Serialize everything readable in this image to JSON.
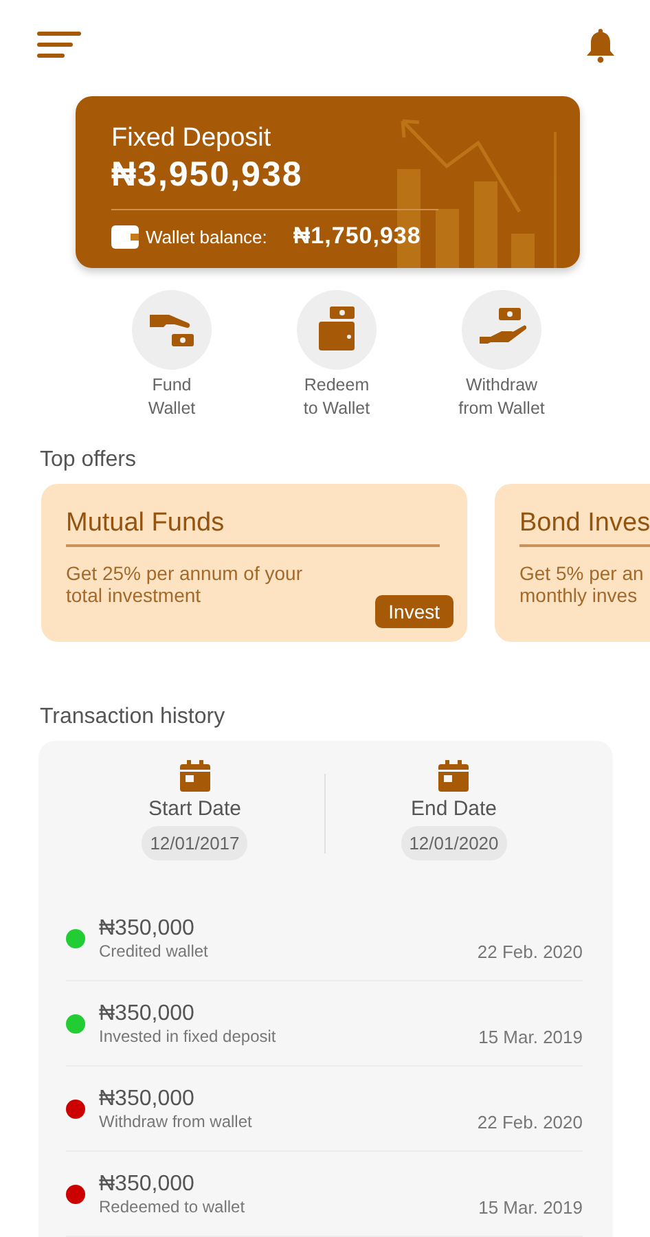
{
  "balance_card": {
    "title": "Fixed Deposit",
    "amount": "₦3,950,938",
    "wallet_label": "Wallet balance:",
    "wallet_amount": "₦1,750,938"
  },
  "actions": [
    {
      "kind": "fund",
      "lines": [
        "Fund",
        "Wallet"
      ]
    },
    {
      "kind": "redeem",
      "lines": [
        "Redeem",
        "to Wallet"
      ]
    },
    {
      "kind": "withdraw",
      "lines": [
        "Withdraw",
        "from Wallet"
      ]
    }
  ],
  "offers_title": "Top offers",
  "offers": [
    {
      "title": "Mutual Funds",
      "description_lines": [
        "Get 25% per annum of your",
        "total investment"
      ],
      "button": "Invest"
    },
    {
      "title": "Bond Inves",
      "description_lines": [
        "Get 5% per an",
        "monthly inves"
      ]
    }
  ],
  "history_title": "Transaction history",
  "date_range": [
    {
      "label": "Start Date",
      "value": "12/01/2017"
    },
    {
      "label": "End Date",
      "value": "12/01/2020"
    }
  ],
  "transactions": [
    {
      "amount": "₦350,000",
      "description": "Credited wallet",
      "date": "22 Feb. 2020",
      "color": "#22cc33"
    },
    {
      "amount": "₦350,000",
      "description": "Invested in fixed deposit",
      "date": "15 Mar. 2019",
      "color": "#22cc33"
    },
    {
      "amount": "₦350,000",
      "description": "Withdraw from wallet",
      "date": "22 Feb. 2020",
      "color": "#cc0000"
    },
    {
      "amount": "₦350,000",
      "description": "Redeemed to wallet",
      "date": "15 Mar. 2019",
      "color": "#cc0000"
    }
  ]
}
